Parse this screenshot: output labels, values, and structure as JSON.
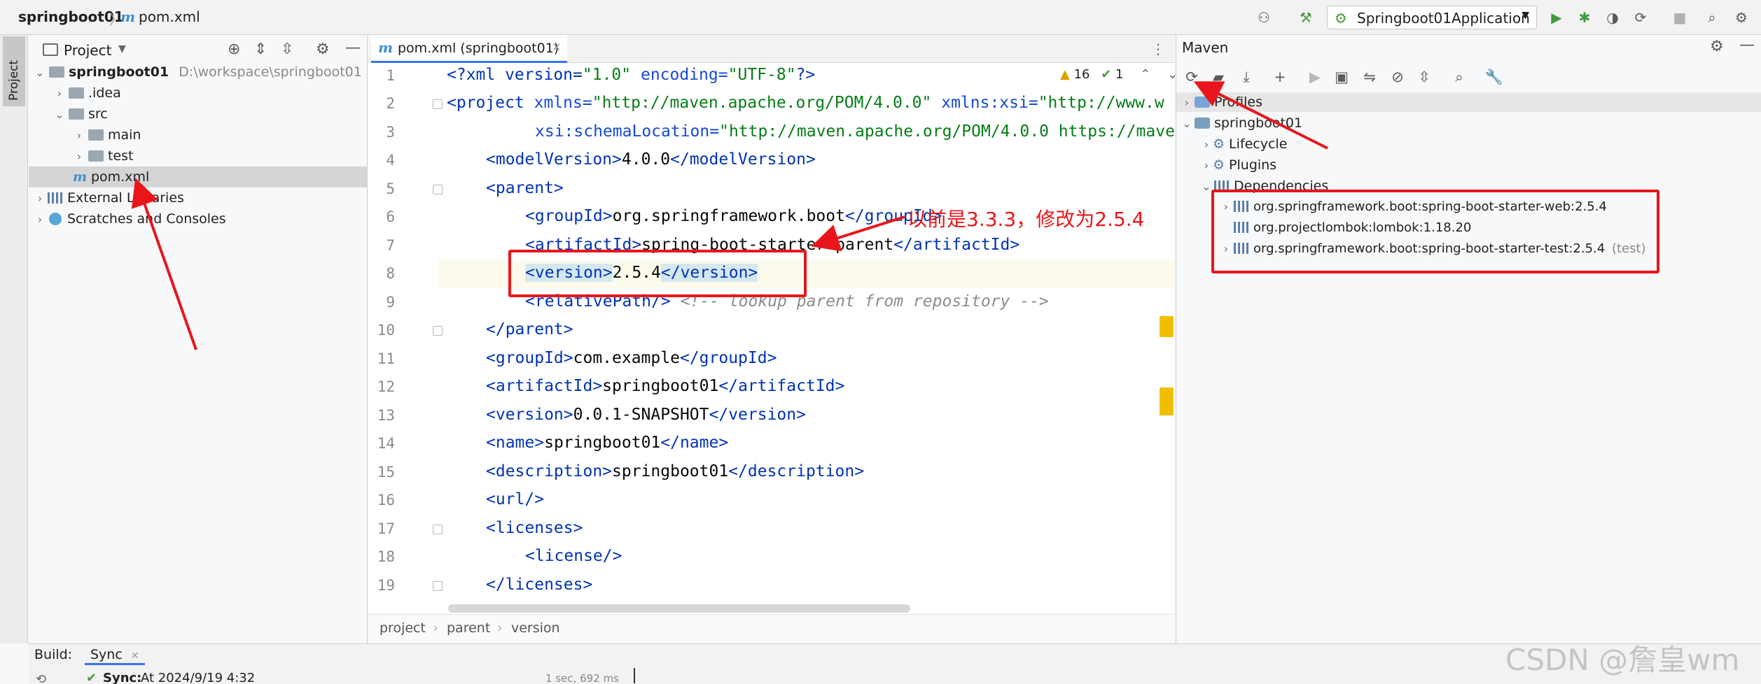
{
  "navbar": {
    "project_name": "springboot01",
    "file_name": "pom.xml",
    "run_config": "Springboot01Application"
  },
  "project_panel": {
    "title": "Project",
    "stripe_label": "Project",
    "tree": [
      {
        "label": "springboot01",
        "path": "D:\\workspace\\springboot01"
      },
      {
        "label": ".idea"
      },
      {
        "label": "src"
      },
      {
        "label": "main"
      },
      {
        "label": "test"
      },
      {
        "label": "pom.xml"
      },
      {
        "label": "External Libraries"
      },
      {
        "label": "Scratches and Consoles"
      }
    ]
  },
  "editor": {
    "tab_label": "pom.xml (springboot01)",
    "warnings": "16",
    "ok_count": "1",
    "line_numbers": [
      "1",
      "2",
      "3",
      "4",
      "5",
      "6",
      "7",
      "8",
      "9",
      "10",
      "11",
      "12",
      "13",
      "14",
      "15",
      "16",
      "17",
      "18",
      "19"
    ],
    "lines": {
      "l1": {
        "a": "<?xml version=",
        "b": "\"1.0\"",
        "c": " encoding=",
        "d": "\"UTF-8\"",
        "e": "?>"
      },
      "l2": {
        "a": "<project ",
        "b": "xmlns=",
        "c": "\"http://maven.apache.org/POM/4.0.0\"",
        "d": " xmlns:xsi=",
        "e": "\"http://www.w"
      },
      "l3": {
        "a": "xsi:schemaLocation=",
        "b": "\"http://maven.apache.org/POM/4.0.0 https://mave"
      },
      "l4": {
        "open": "<modelVersion>",
        "text": "4.0.0",
        "close": "</modelVersion>"
      },
      "l5": {
        "open": "<parent>"
      },
      "l6": {
        "open": "<groupId>",
        "text": "org.springframework.boot",
        "close": "</groupId>"
      },
      "l7": {
        "open": "<artifactId>",
        "text": "spring-boot-starter-parent",
        "close": "</artifactId>"
      },
      "l8": {
        "open": "<version>",
        "text": "2.5.4",
        "close": "</version>"
      },
      "l9": {
        "open": "<relativePath/>",
        "comment": " <!-- lookup parent from repository -->"
      },
      "l10": {
        "open": "</parent>"
      },
      "l11": {
        "open": "<groupId>",
        "text": "com.example",
        "close": "</groupId>"
      },
      "l12": {
        "open": "<artifactId>",
        "text": "springboot01",
        "close": "</artifactId>"
      },
      "l13": {
        "open": "<version>",
        "text": "0.0.1-SNAPSHOT",
        "close": "</version>"
      },
      "l14": {
        "open": "<name>",
        "text": "springboot01",
        "close": "</name>"
      },
      "l15": {
        "open": "<description>",
        "text": "springboot01",
        "close": "</description>"
      },
      "l16": {
        "open": "<url/>"
      },
      "l17": {
        "open": "<licenses>"
      },
      "l18": {
        "open": "<license/>"
      },
      "l19": {
        "open": "</licenses>"
      }
    },
    "breadcrumb": [
      "project",
      "parent",
      "version"
    ]
  },
  "maven": {
    "title": "Maven",
    "tree": {
      "profiles": "Profiles",
      "root": "springboot01",
      "lifecycle": "Lifecycle",
      "plugins": "Plugins",
      "dependencies": "Dependencies",
      "deps": [
        {
          "label": "org.springframework.boot:spring-boot-starter-web:2.5.4",
          "scope": ""
        },
        {
          "label": "org.projectlombok:lombok:1.18.20",
          "scope": ""
        },
        {
          "label": "org.springframework.boot:spring-boot-starter-test:2.5.4",
          "scope": "(test)"
        }
      ]
    }
  },
  "annotation": {
    "note": "以前是3.3.3，修改为2.5.4"
  },
  "build": {
    "label": "Build:",
    "tab": "Sync",
    "sync_label": "Sync:",
    "sync_time": "At 2024/9/19 4:32",
    "duration": "1 sec, 692 ms"
  },
  "watermark": "CSDN @詹皇wm",
  "colors": {
    "accent": "#3574f0",
    "annotation": "#e8161b",
    "warning": "#f0c000"
  }
}
